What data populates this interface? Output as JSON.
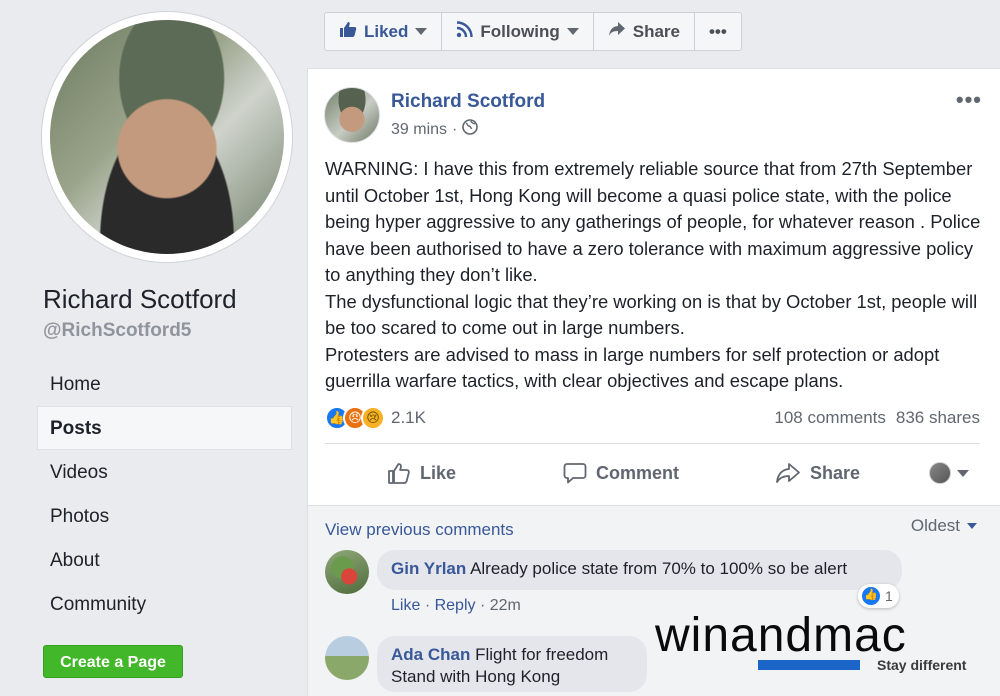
{
  "sidebar": {
    "page_name": "Richard Scotford",
    "handle": "@RichScotford5",
    "nav": [
      {
        "label": "Home",
        "active": false
      },
      {
        "label": "Posts",
        "active": true
      },
      {
        "label": "Videos",
        "active": false
      },
      {
        "label": "Photos",
        "active": false
      },
      {
        "label": "About",
        "active": false
      },
      {
        "label": "Community",
        "active": false
      }
    ],
    "create_page": "Create a Page"
  },
  "actionbar": {
    "liked": "Liked",
    "following": "Following",
    "share": "Share",
    "more": "•••"
  },
  "post": {
    "author": "Richard Scotford",
    "time": "39 mins",
    "separator": "·",
    "more": "•••",
    "paragraphs": [
      "WARNING: I have this from extremely reliable source that from 27th September until October 1st, Hong Kong will become a quasi police state, with the police being hyper aggressive to any gatherings of people, for whatever reason . Police have been authorised to have a zero tolerance with maximum aggressive policy to anything they don’t like.",
      "The dysfunctional logic that they’re working on is that by October 1st, people will be too scared to come out in large numbers.",
      "Protesters are advised to mass in large numbers for self protection or adopt guerrilla warfare tactics, with clear objectives and escape plans."
    ],
    "reactions_count": "2.1K",
    "comments_count": "108 comments",
    "shares_count": "836 shares",
    "actions": {
      "like": "Like",
      "comment": "Comment",
      "share": "Share"
    }
  },
  "comments": {
    "view_previous": "View previous comments",
    "sort": "Oldest",
    "items": [
      {
        "name": "Gin Yrlan",
        "text": "Already police state from 70% to 100% so be alert",
        "like": "Like",
        "reply": "Reply",
        "time": "22m",
        "likes": "1"
      },
      {
        "name": "Ada Chan",
        "text_line1": "Flight for freedom",
        "text_line2": "Stand with Hong Kong"
      }
    ]
  },
  "watermark": {
    "left": "win",
    "mid": "and",
    "right": "mac",
    "tagline": "Stay different"
  },
  "colors": {
    "link": "#385898",
    "green": "#42b72a",
    "like_blue": "#1877f2"
  }
}
